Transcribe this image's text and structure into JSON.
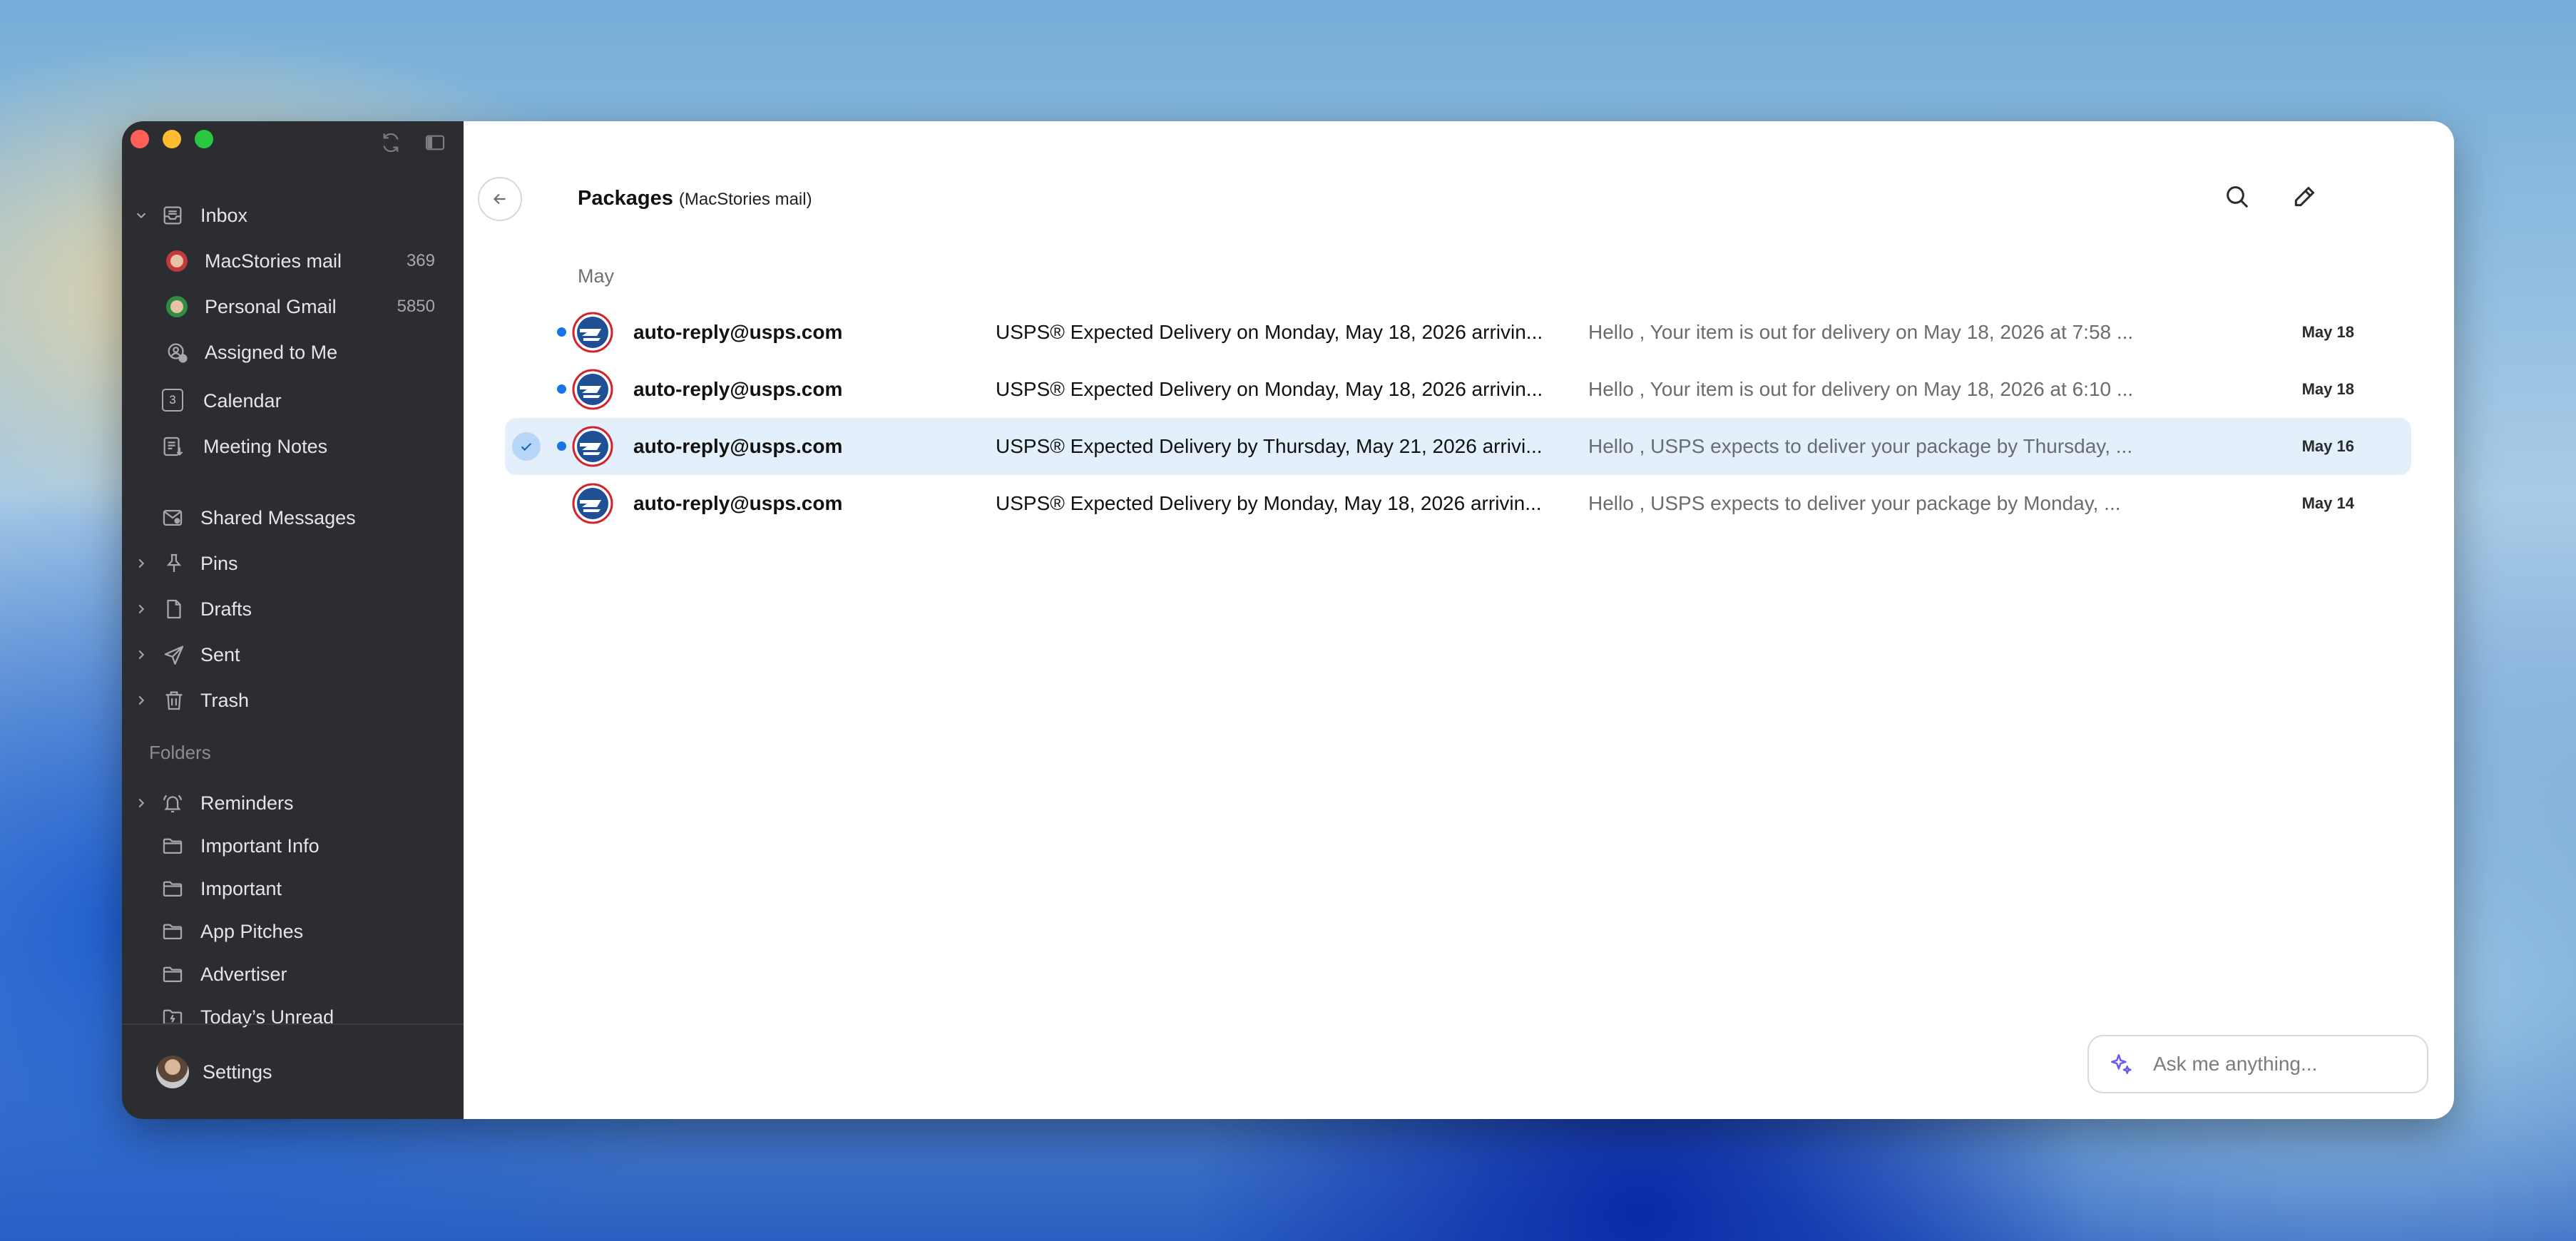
{
  "sidebar": {
    "items": [
      {
        "label": "Inbox",
        "icon": "inbox-icon",
        "count": "",
        "chevron": "down"
      },
      {
        "label": "MacStories mail",
        "icon": "avatar-icon",
        "count": "369",
        "chevron": ""
      },
      {
        "label": "Personal Gmail",
        "icon": "avatar-icon",
        "count": "5850",
        "chevron": ""
      },
      {
        "label": "Assigned to Me",
        "icon": "assigned-icon",
        "count": "",
        "chevron": ""
      },
      {
        "label": "Calendar",
        "icon": "calendar-icon",
        "count": "",
        "chevron": ""
      },
      {
        "label": "Meeting Notes",
        "icon": "notes-icon",
        "count": "",
        "chevron": ""
      },
      {
        "label": "Shared Messages",
        "icon": "shared-icon",
        "count": "",
        "chevron": ""
      },
      {
        "label": "Pins",
        "icon": "pin-icon",
        "count": "",
        "chevron": "right"
      },
      {
        "label": "Drafts",
        "icon": "draft-icon",
        "count": "",
        "chevron": "right"
      },
      {
        "label": "Sent",
        "icon": "send-icon",
        "count": "",
        "chevron": "right"
      },
      {
        "label": "Trash",
        "icon": "trash-icon",
        "count": "",
        "chevron": "right"
      }
    ],
    "calendar_day": "3",
    "folders_header": "Folders",
    "folders": [
      {
        "label": "Reminders",
        "icon": "bell-icon",
        "chevron": "right"
      },
      {
        "label": "Important Info",
        "icon": "folder-icon",
        "chevron": ""
      },
      {
        "label": "Important",
        "icon": "folder-icon",
        "chevron": ""
      },
      {
        "label": "App Pitches",
        "icon": "folder-icon",
        "chevron": ""
      },
      {
        "label": "Advertiser",
        "icon": "folder-icon",
        "chevron": ""
      },
      {
        "label": "Today’s Unread",
        "icon": "smart-folder-icon",
        "chevron": ""
      }
    ],
    "settings_label": "Settings"
  },
  "header": {
    "title": "Packages",
    "subtitle": "(MacStories mail)"
  },
  "list": {
    "group_label": "May",
    "rows": [
      {
        "sender": "auto-reply@usps.com",
        "subject": "USPS® Expected Delivery on Monday, May 18, 2026 arrivin...",
        "preview": "Hello , Your item is out for delivery on May 18, 2026 at 7:58 ...",
        "date": "May 18",
        "unread": true,
        "selected": false
      },
      {
        "sender": "auto-reply@usps.com",
        "subject": "USPS® Expected Delivery on Monday, May 18, 2026 arrivin...",
        "preview": "Hello , Your item is out for delivery on May 18, 2026 at 6:10 ...",
        "date": "May 18",
        "unread": true,
        "selected": false
      },
      {
        "sender": "auto-reply@usps.com",
        "subject": "USPS® Expected Delivery by Thursday, May 21, 2026 arrivi...",
        "preview": "Hello , USPS expects to deliver your package by Thursday, ...",
        "date": "May 16",
        "unread": true,
        "selected": true
      },
      {
        "sender": "auto-reply@usps.com",
        "subject": "USPS® Expected Delivery by Monday, May 18, 2026 arrivin...",
        "preview": "Hello , USPS expects to deliver your package by Monday, ...",
        "date": "May 14",
        "unread": false,
        "selected": false
      }
    ]
  },
  "assistant": {
    "placeholder": "Ask me anything..."
  },
  "colors": {
    "sidebar_bg": "#2c2d30",
    "accent": "#1a73e8",
    "selected_row": "#e3f0fc"
  }
}
